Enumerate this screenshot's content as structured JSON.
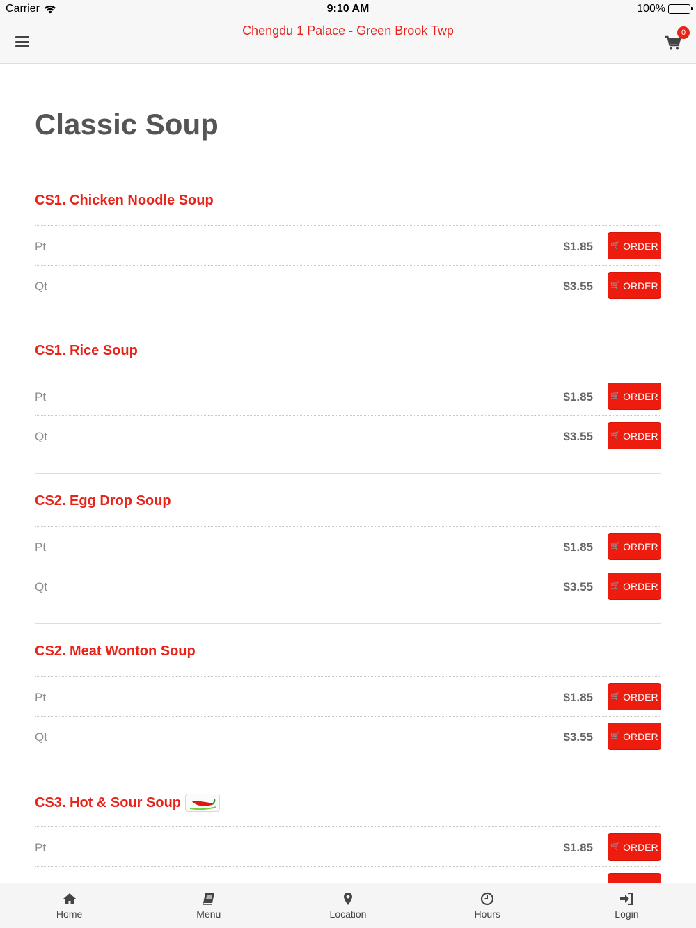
{
  "status_bar": {
    "carrier": "Carrier",
    "time": "9:10 AM",
    "battery": "100%"
  },
  "header": {
    "title": "Chengdu 1 Palace - Green Brook Twp",
    "cart_count": "0",
    "menu_icon": "hamburger-icon",
    "cart_icon": "cart-icon"
  },
  "page": {
    "title": "Classic Soup"
  },
  "items": [
    {
      "name": "CS1. Chicken Noodle Soup",
      "spicy": false,
      "options": [
        {
          "size": "Pt",
          "price": "$1.85"
        },
        {
          "size": "Qt",
          "price": "$3.55"
        }
      ]
    },
    {
      "name": "CS1. Rice Soup",
      "spicy": false,
      "options": [
        {
          "size": "Pt",
          "price": "$1.85"
        },
        {
          "size": "Qt",
          "price": "$3.55"
        }
      ]
    },
    {
      "name": "CS2. Egg Drop Soup",
      "spicy": false,
      "options": [
        {
          "size": "Pt",
          "price": "$1.85"
        },
        {
          "size": "Qt",
          "price": "$3.55"
        }
      ]
    },
    {
      "name": "CS2. Meat Wonton Soup",
      "spicy": false,
      "options": [
        {
          "size": "Pt",
          "price": "$1.85"
        },
        {
          "size": "Qt",
          "price": "$3.55"
        }
      ]
    },
    {
      "name": "CS3. Hot & Sour Soup",
      "spicy": true,
      "options": [
        {
          "size": "Pt",
          "price": "$1.85"
        }
      ]
    }
  ],
  "order_label": "ORDER",
  "tabs": [
    {
      "label": "Home",
      "icon": "home-icon"
    },
    {
      "label": "Menu",
      "icon": "book-icon"
    },
    {
      "label": "Location",
      "icon": "map-pin-icon"
    },
    {
      "label": "Hours",
      "icon": "clock-icon"
    },
    {
      "label": "Login",
      "icon": "login-icon"
    }
  ],
  "colors": {
    "accent": "#ee1c0f",
    "title_red": "#e8231a",
    "bar_bg": "#f7f7f7"
  }
}
